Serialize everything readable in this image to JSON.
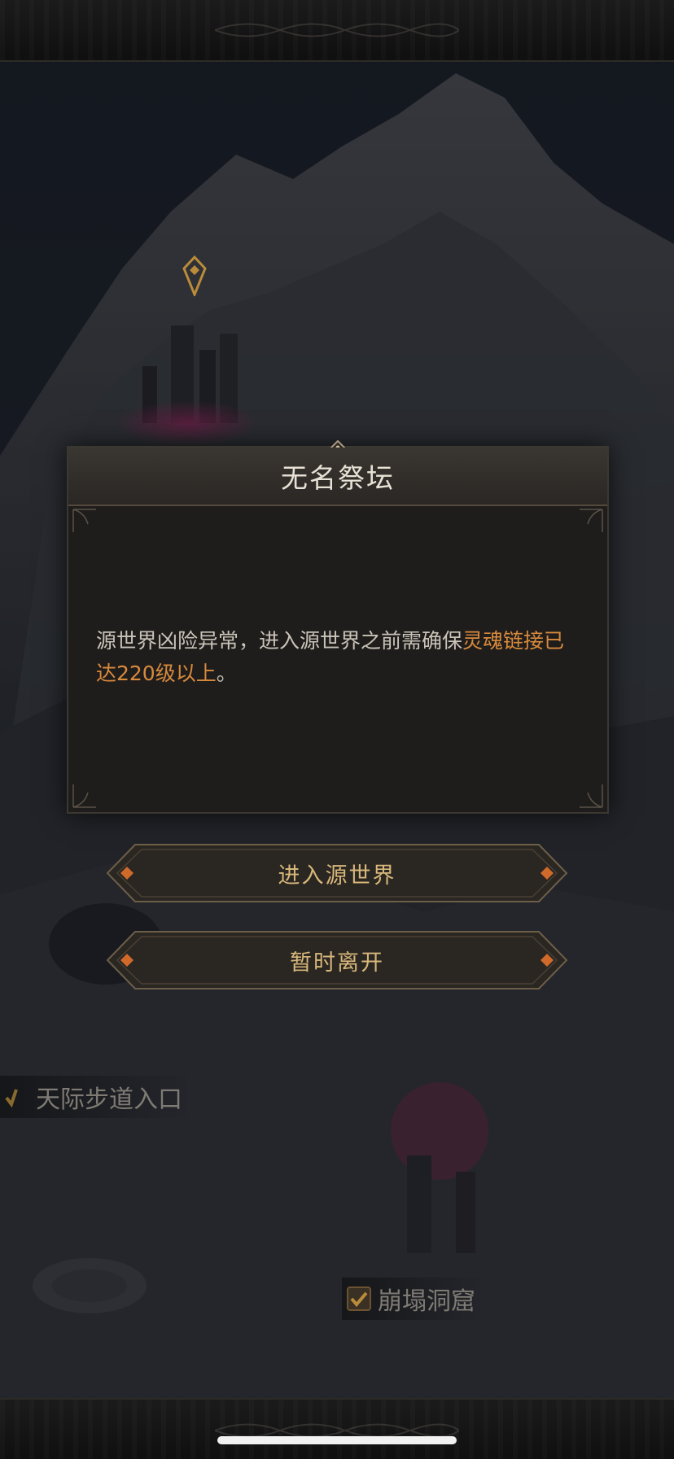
{
  "dialog": {
    "title": "无名祭坛",
    "message_prefix": "源世界凶险异常，进入源世界之前需确保",
    "message_highlight": "灵魂链接已达220级以上",
    "message_suffix": "。"
  },
  "buttons": {
    "enter_label": "进入源世界",
    "leave_label": "暂时离开"
  },
  "map": {
    "labels": [
      "天际步道入口",
      "崩塌洞窟"
    ]
  },
  "colors": {
    "accent_orange": "#d88a3c",
    "button_text": "#d7b77a",
    "title_text": "#e8e2d6"
  }
}
